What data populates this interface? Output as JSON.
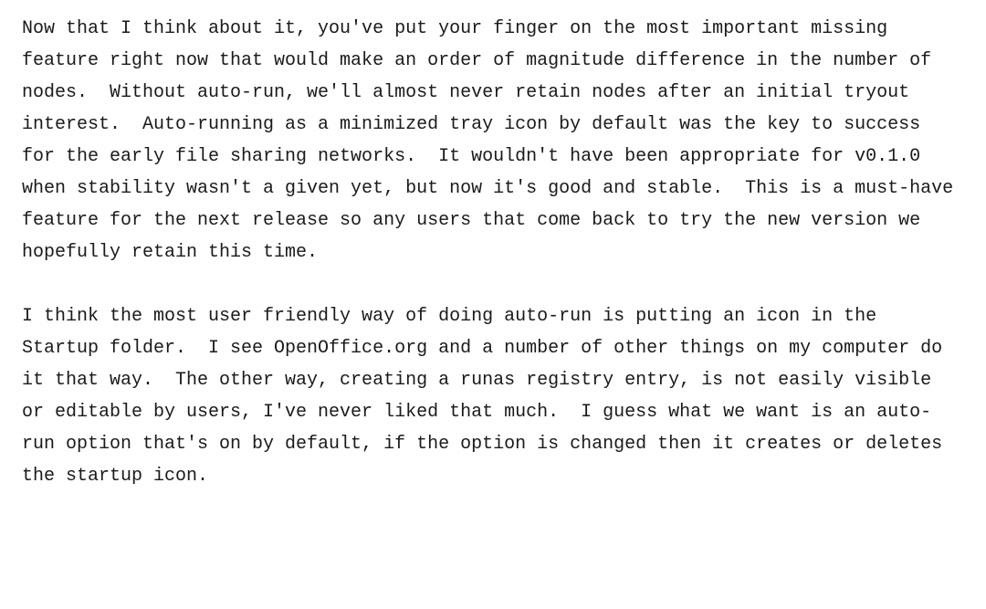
{
  "document": {
    "paragraphs": [
      "Now that I think about it, you've put your finger on the most important missing feature right now that would make an order of magnitude difference in the number of nodes.  Without auto-run, we'll almost never retain nodes after an initial tryout interest.  Auto-running as a minimized tray icon by default was the key to success for the early file sharing networks.  It wouldn't have been appropriate for v0.1.0 when stability wasn't a given yet, but now it's good and stable.  This is a must-have feature for the next release so any users that come back to try the new version we hopefully retain this time.",
      "I think the most user friendly way of doing auto-run is putting an icon in the Startup folder.  I see OpenOffice.org and a number of other things on my computer do it that way.  The other way, creating a runas registry entry, is not easily visible or editable by users, I've never liked that much.  I guess what we want is an auto-run option that's on by default, if the option is changed then it creates or deletes the startup icon."
    ]
  }
}
